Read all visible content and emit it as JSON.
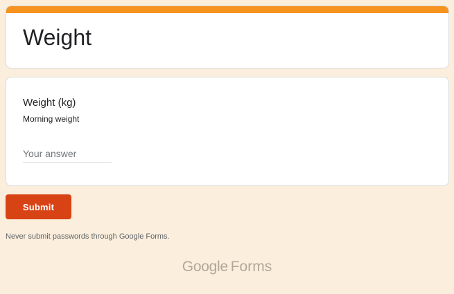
{
  "form": {
    "title": "Weight",
    "accent_color": "#f6921e",
    "background_color": "#fbeedc"
  },
  "question": {
    "title": "Weight (kg)",
    "description": "Morning weight",
    "placeholder": "Your answer",
    "value": ""
  },
  "actions": {
    "submit_label": "Submit",
    "submit_color": "#d84315"
  },
  "footer": {
    "disclaimer": "Never submit passwords through Google Forms.",
    "logo_brand": "Google",
    "logo_product": "Forms"
  }
}
